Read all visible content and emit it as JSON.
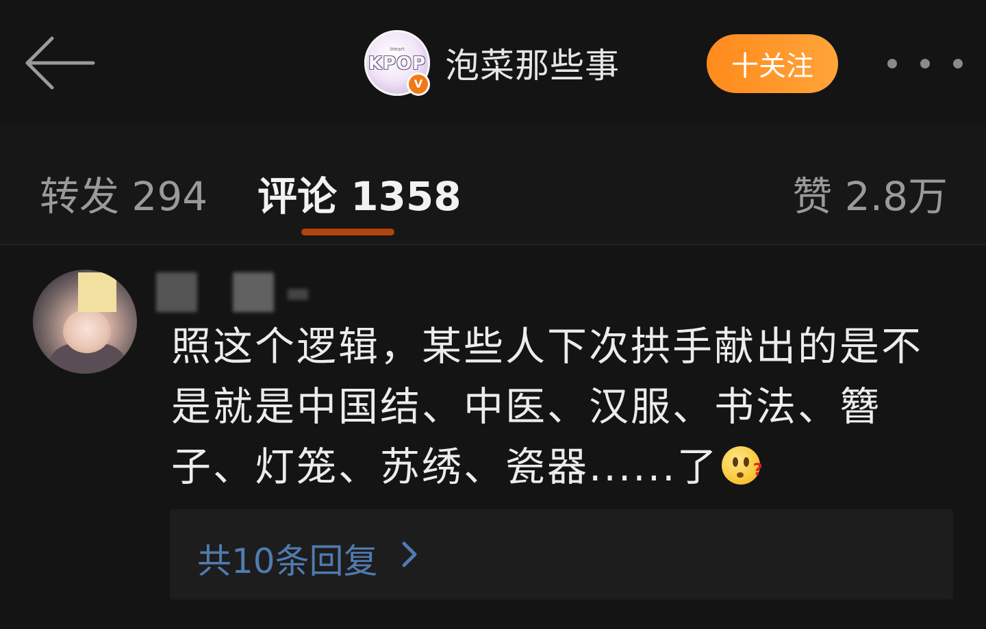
{
  "header": {
    "account_name": "泡菜那些事",
    "logo_text": "KPOP",
    "logo_small": "iHeart",
    "verified_badge": "V",
    "follow_label": "十关注",
    "back_icon": "back-arrow-icon",
    "more_icon": "more-dots-icon"
  },
  "tabs": {
    "repost": "转发 294",
    "comment": "评论 1358",
    "like": "赞 2.8万",
    "active": "comment"
  },
  "comment": {
    "username": "",
    "text": "照这个逻辑，某些人下次拱手献出的是不是就是中国结、中医、汉服、书法、簪子、灯笼、苏绣、瓷器......了",
    "emoji": "confused-face-emoji",
    "emoji_mark": "?",
    "replies_label": "共10条回复"
  },
  "colors": {
    "background": "#141414",
    "accent_orange": "#ff9226",
    "tab_underline": "#b2440f",
    "link_blue": "#4f7bb0"
  }
}
